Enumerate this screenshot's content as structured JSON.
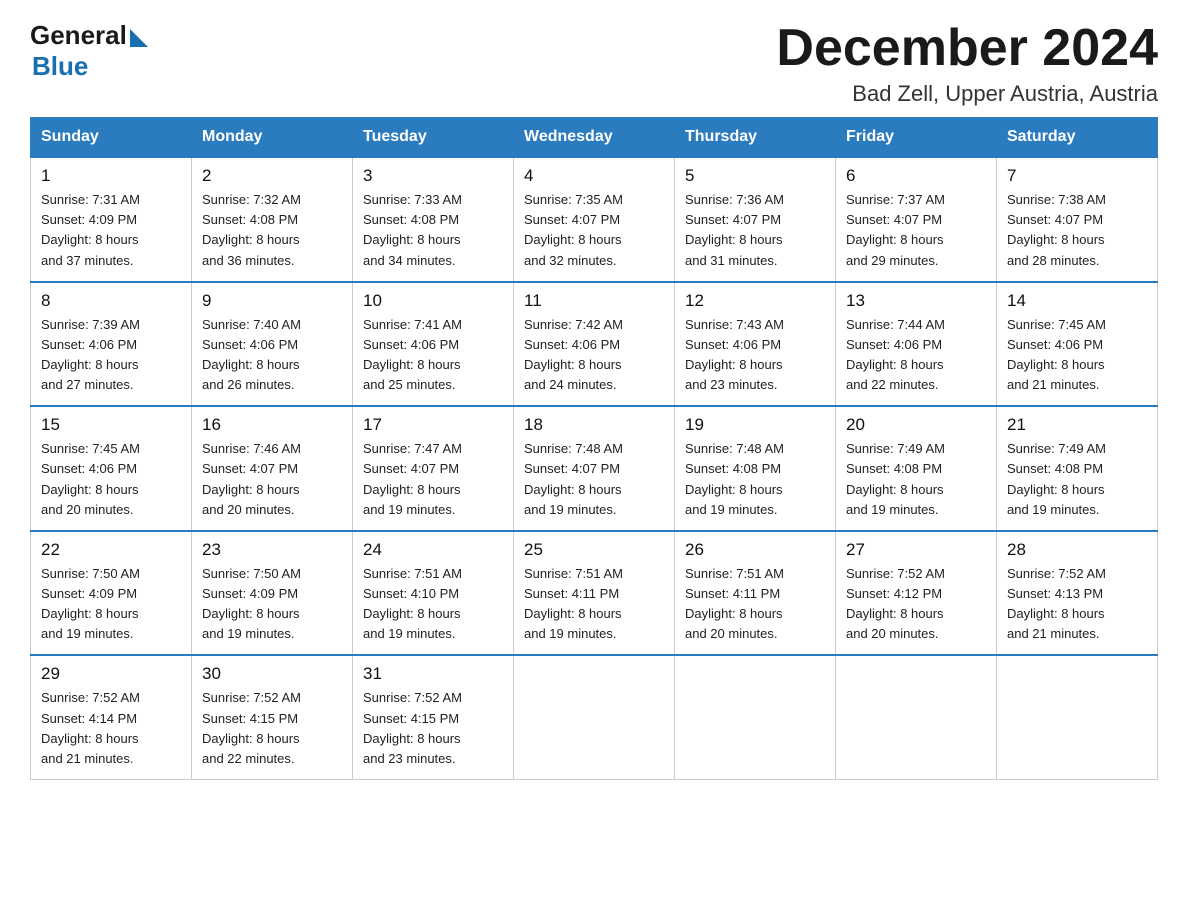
{
  "logo": {
    "general": "General",
    "blue": "Blue"
  },
  "title": "December 2024",
  "location": "Bad Zell, Upper Austria, Austria",
  "days_of_week": [
    "Sunday",
    "Monday",
    "Tuesday",
    "Wednesday",
    "Thursday",
    "Friday",
    "Saturday"
  ],
  "weeks": [
    [
      {
        "day": "1",
        "sunrise": "7:31 AM",
        "sunset": "4:09 PM",
        "daylight": "8 hours and 37 minutes."
      },
      {
        "day": "2",
        "sunrise": "7:32 AM",
        "sunset": "4:08 PM",
        "daylight": "8 hours and 36 minutes."
      },
      {
        "day": "3",
        "sunrise": "7:33 AM",
        "sunset": "4:08 PM",
        "daylight": "8 hours and 34 minutes."
      },
      {
        "day": "4",
        "sunrise": "7:35 AM",
        "sunset": "4:07 PM",
        "daylight": "8 hours and 32 minutes."
      },
      {
        "day": "5",
        "sunrise": "7:36 AM",
        "sunset": "4:07 PM",
        "daylight": "8 hours and 31 minutes."
      },
      {
        "day": "6",
        "sunrise": "7:37 AM",
        "sunset": "4:07 PM",
        "daylight": "8 hours and 29 minutes."
      },
      {
        "day": "7",
        "sunrise": "7:38 AM",
        "sunset": "4:07 PM",
        "daylight": "8 hours and 28 minutes."
      }
    ],
    [
      {
        "day": "8",
        "sunrise": "7:39 AM",
        "sunset": "4:06 PM",
        "daylight": "8 hours and 27 minutes."
      },
      {
        "day": "9",
        "sunrise": "7:40 AM",
        "sunset": "4:06 PM",
        "daylight": "8 hours and 26 minutes."
      },
      {
        "day": "10",
        "sunrise": "7:41 AM",
        "sunset": "4:06 PM",
        "daylight": "8 hours and 25 minutes."
      },
      {
        "day": "11",
        "sunrise": "7:42 AM",
        "sunset": "4:06 PM",
        "daylight": "8 hours and 24 minutes."
      },
      {
        "day": "12",
        "sunrise": "7:43 AM",
        "sunset": "4:06 PM",
        "daylight": "8 hours and 23 minutes."
      },
      {
        "day": "13",
        "sunrise": "7:44 AM",
        "sunset": "4:06 PM",
        "daylight": "8 hours and 22 minutes."
      },
      {
        "day": "14",
        "sunrise": "7:45 AM",
        "sunset": "4:06 PM",
        "daylight": "8 hours and 21 minutes."
      }
    ],
    [
      {
        "day": "15",
        "sunrise": "7:45 AM",
        "sunset": "4:06 PM",
        "daylight": "8 hours and 20 minutes."
      },
      {
        "day": "16",
        "sunrise": "7:46 AM",
        "sunset": "4:07 PM",
        "daylight": "8 hours and 20 minutes."
      },
      {
        "day": "17",
        "sunrise": "7:47 AM",
        "sunset": "4:07 PM",
        "daylight": "8 hours and 19 minutes."
      },
      {
        "day": "18",
        "sunrise": "7:48 AM",
        "sunset": "4:07 PM",
        "daylight": "8 hours and 19 minutes."
      },
      {
        "day": "19",
        "sunrise": "7:48 AM",
        "sunset": "4:08 PM",
        "daylight": "8 hours and 19 minutes."
      },
      {
        "day": "20",
        "sunrise": "7:49 AM",
        "sunset": "4:08 PM",
        "daylight": "8 hours and 19 minutes."
      },
      {
        "day": "21",
        "sunrise": "7:49 AM",
        "sunset": "4:08 PM",
        "daylight": "8 hours and 19 minutes."
      }
    ],
    [
      {
        "day": "22",
        "sunrise": "7:50 AM",
        "sunset": "4:09 PM",
        "daylight": "8 hours and 19 minutes."
      },
      {
        "day": "23",
        "sunrise": "7:50 AM",
        "sunset": "4:09 PM",
        "daylight": "8 hours and 19 minutes."
      },
      {
        "day": "24",
        "sunrise": "7:51 AM",
        "sunset": "4:10 PM",
        "daylight": "8 hours and 19 minutes."
      },
      {
        "day": "25",
        "sunrise": "7:51 AM",
        "sunset": "4:11 PM",
        "daylight": "8 hours and 19 minutes."
      },
      {
        "day": "26",
        "sunrise": "7:51 AM",
        "sunset": "4:11 PM",
        "daylight": "8 hours and 20 minutes."
      },
      {
        "day": "27",
        "sunrise": "7:52 AM",
        "sunset": "4:12 PM",
        "daylight": "8 hours and 20 minutes."
      },
      {
        "day": "28",
        "sunrise": "7:52 AM",
        "sunset": "4:13 PM",
        "daylight": "8 hours and 21 minutes."
      }
    ],
    [
      {
        "day": "29",
        "sunrise": "7:52 AM",
        "sunset": "4:14 PM",
        "daylight": "8 hours and 21 minutes."
      },
      {
        "day": "30",
        "sunrise": "7:52 AM",
        "sunset": "4:15 PM",
        "daylight": "8 hours and 22 minutes."
      },
      {
        "day": "31",
        "sunrise": "7:52 AM",
        "sunset": "4:15 PM",
        "daylight": "8 hours and 23 minutes."
      },
      null,
      null,
      null,
      null
    ]
  ],
  "labels": {
    "sunrise": "Sunrise:",
    "sunset": "Sunset:",
    "daylight": "Daylight:"
  }
}
